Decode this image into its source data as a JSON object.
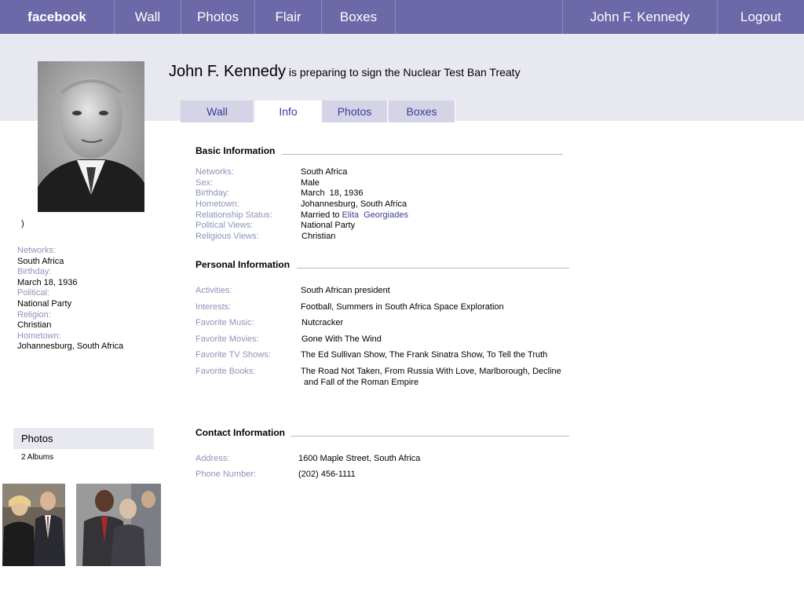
{
  "topbar": {
    "brand": "facebook",
    "nav": [
      "Wall",
      "Photos",
      "Flair",
      "Boxes"
    ],
    "user": "John F. Kennedy",
    "logout": "Logout"
  },
  "profile": {
    "name": "John F. Kennedy",
    "status": "is preparing to sign the Nuclear Test Ban Treaty"
  },
  "tabs": [
    "Wall",
    "Info",
    "Photos",
    "Boxes"
  ],
  "sidebar": {
    "paren": ")",
    "fields": [
      {
        "label": "Networks:",
        "value": "South Africa"
      },
      {
        "label": "Birthday:",
        "value": "March 18, 1936"
      },
      {
        "label": "Political:",
        "value": "National Party"
      },
      {
        "label": "Religion:",
        "value": "Christian"
      },
      {
        "label": "Hometown:",
        "value": "Johannesburg, South Africa"
      }
    ],
    "photos_title": "Photos",
    "albums": "2 Albums"
  },
  "basic": {
    "title": "Basic Information",
    "rows": [
      {
        "label": "Networks:",
        "value": "South Africa"
      },
      {
        "label": "Sex:",
        "value": "Male"
      },
      {
        "label": "Birthday:",
        "value": "March  18, 1936"
      },
      {
        "label": "Hometown:",
        "value": "Johannesburg, South Africa"
      },
      {
        "label": "Relationship Status:",
        "value": "Married to",
        "link": "Elita  Georgiades"
      },
      {
        "label": "Political Views:",
        "value": "National Party"
      },
      {
        "label": "Religious Views:",
        "value": "Christian"
      }
    ]
  },
  "personal": {
    "title": "Personal Information",
    "rows": [
      {
        "label": "Activities:",
        "value": "South African president"
      },
      {
        "label": "Interests:",
        "value": "Football, Summers in South Africa Space Exploration"
      },
      {
        "label": "Favorite Music:",
        "value": "Nutcracker"
      },
      {
        "label": "Favorite Movies:",
        "value": "Gone With The Wind"
      },
      {
        "label": "Favorite TV Shows:",
        "value": "The Ed Sullivan Show, The Frank Sinatra Show, To Tell the Truth"
      },
      {
        "label": "Favorite Books:",
        "value": "The Road Not Taken, From Russia With Love, Marlborough, Decline",
        "value2": "and Fall of the Roman Empire"
      }
    ]
  },
  "contact": {
    "title": "Contact Information",
    "rows": [
      {
        "label": "Address:",
        "value": "1600 Maple Street, South Africa"
      },
      {
        "label": "Phone Number:",
        "value": "(202) 456-1111"
      }
    ]
  },
  "colors": {
    "topbar": "#6d68a8",
    "band": "#e8e8f0",
    "label": "#8c93bd",
    "link": "#3b3b9a"
  }
}
